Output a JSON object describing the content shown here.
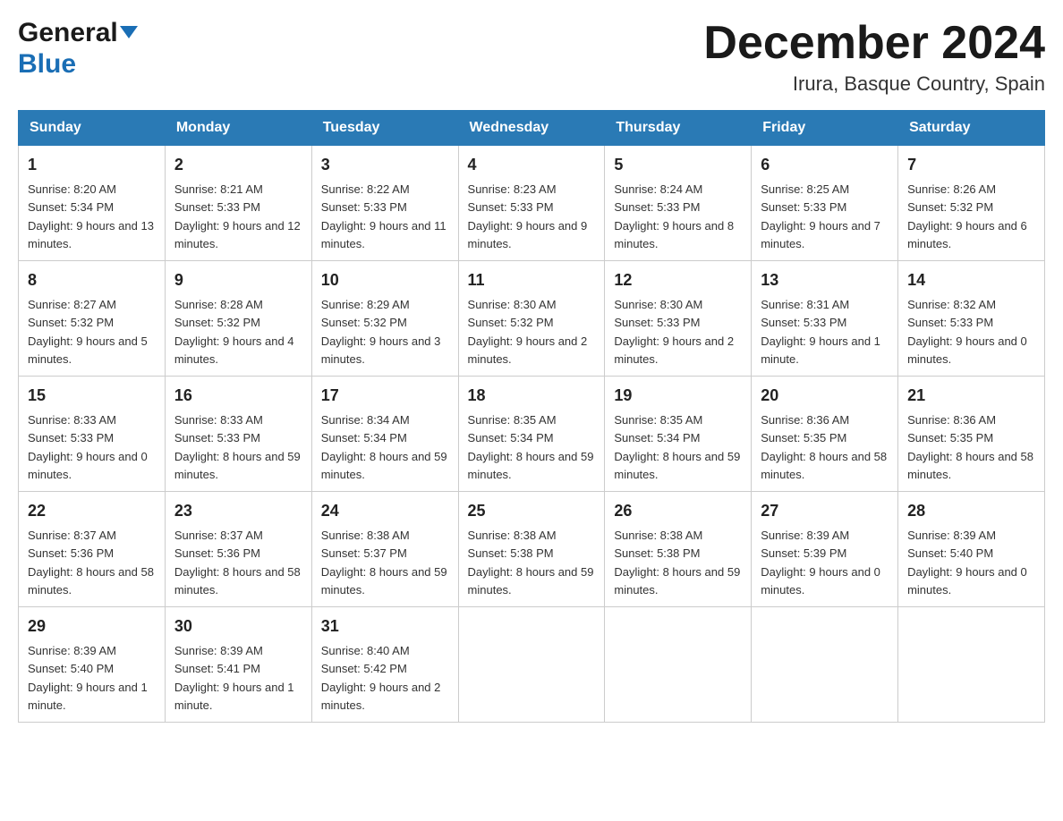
{
  "header": {
    "logo_general": "General",
    "logo_blue": "Blue",
    "month_title": "December 2024",
    "location": "Irura, Basque Country, Spain"
  },
  "days_of_week": [
    "Sunday",
    "Monday",
    "Tuesday",
    "Wednesday",
    "Thursday",
    "Friday",
    "Saturday"
  ],
  "weeks": [
    [
      {
        "day": "1",
        "sunrise": "8:20 AM",
        "sunset": "5:34 PM",
        "daylight": "9 hours and 13 minutes."
      },
      {
        "day": "2",
        "sunrise": "8:21 AM",
        "sunset": "5:33 PM",
        "daylight": "9 hours and 12 minutes."
      },
      {
        "day": "3",
        "sunrise": "8:22 AM",
        "sunset": "5:33 PM",
        "daylight": "9 hours and 11 minutes."
      },
      {
        "day": "4",
        "sunrise": "8:23 AM",
        "sunset": "5:33 PM",
        "daylight": "9 hours and 9 minutes."
      },
      {
        "day": "5",
        "sunrise": "8:24 AM",
        "sunset": "5:33 PM",
        "daylight": "9 hours and 8 minutes."
      },
      {
        "day": "6",
        "sunrise": "8:25 AM",
        "sunset": "5:33 PM",
        "daylight": "9 hours and 7 minutes."
      },
      {
        "day": "7",
        "sunrise": "8:26 AM",
        "sunset": "5:32 PM",
        "daylight": "9 hours and 6 minutes."
      }
    ],
    [
      {
        "day": "8",
        "sunrise": "8:27 AM",
        "sunset": "5:32 PM",
        "daylight": "9 hours and 5 minutes."
      },
      {
        "day": "9",
        "sunrise": "8:28 AM",
        "sunset": "5:32 PM",
        "daylight": "9 hours and 4 minutes."
      },
      {
        "day": "10",
        "sunrise": "8:29 AM",
        "sunset": "5:32 PM",
        "daylight": "9 hours and 3 minutes."
      },
      {
        "day": "11",
        "sunrise": "8:30 AM",
        "sunset": "5:32 PM",
        "daylight": "9 hours and 2 minutes."
      },
      {
        "day": "12",
        "sunrise": "8:30 AM",
        "sunset": "5:33 PM",
        "daylight": "9 hours and 2 minutes."
      },
      {
        "day": "13",
        "sunrise": "8:31 AM",
        "sunset": "5:33 PM",
        "daylight": "9 hours and 1 minute."
      },
      {
        "day": "14",
        "sunrise": "8:32 AM",
        "sunset": "5:33 PM",
        "daylight": "9 hours and 0 minutes."
      }
    ],
    [
      {
        "day": "15",
        "sunrise": "8:33 AM",
        "sunset": "5:33 PM",
        "daylight": "9 hours and 0 minutes."
      },
      {
        "day": "16",
        "sunrise": "8:33 AM",
        "sunset": "5:33 PM",
        "daylight": "8 hours and 59 minutes."
      },
      {
        "day": "17",
        "sunrise": "8:34 AM",
        "sunset": "5:34 PM",
        "daylight": "8 hours and 59 minutes."
      },
      {
        "day": "18",
        "sunrise": "8:35 AM",
        "sunset": "5:34 PM",
        "daylight": "8 hours and 59 minutes."
      },
      {
        "day": "19",
        "sunrise": "8:35 AM",
        "sunset": "5:34 PM",
        "daylight": "8 hours and 59 minutes."
      },
      {
        "day": "20",
        "sunrise": "8:36 AM",
        "sunset": "5:35 PM",
        "daylight": "8 hours and 58 minutes."
      },
      {
        "day": "21",
        "sunrise": "8:36 AM",
        "sunset": "5:35 PM",
        "daylight": "8 hours and 58 minutes."
      }
    ],
    [
      {
        "day": "22",
        "sunrise": "8:37 AM",
        "sunset": "5:36 PM",
        "daylight": "8 hours and 58 minutes."
      },
      {
        "day": "23",
        "sunrise": "8:37 AM",
        "sunset": "5:36 PM",
        "daylight": "8 hours and 58 minutes."
      },
      {
        "day": "24",
        "sunrise": "8:38 AM",
        "sunset": "5:37 PM",
        "daylight": "8 hours and 59 minutes."
      },
      {
        "day": "25",
        "sunrise": "8:38 AM",
        "sunset": "5:38 PM",
        "daylight": "8 hours and 59 minutes."
      },
      {
        "day": "26",
        "sunrise": "8:38 AM",
        "sunset": "5:38 PM",
        "daylight": "8 hours and 59 minutes."
      },
      {
        "day": "27",
        "sunrise": "8:39 AM",
        "sunset": "5:39 PM",
        "daylight": "9 hours and 0 minutes."
      },
      {
        "day": "28",
        "sunrise": "8:39 AM",
        "sunset": "5:40 PM",
        "daylight": "9 hours and 0 minutes."
      }
    ],
    [
      {
        "day": "29",
        "sunrise": "8:39 AM",
        "sunset": "5:40 PM",
        "daylight": "9 hours and 1 minute."
      },
      {
        "day": "30",
        "sunrise": "8:39 AM",
        "sunset": "5:41 PM",
        "daylight": "9 hours and 1 minute."
      },
      {
        "day": "31",
        "sunrise": "8:40 AM",
        "sunset": "5:42 PM",
        "daylight": "9 hours and 2 minutes."
      },
      null,
      null,
      null,
      null
    ]
  ]
}
